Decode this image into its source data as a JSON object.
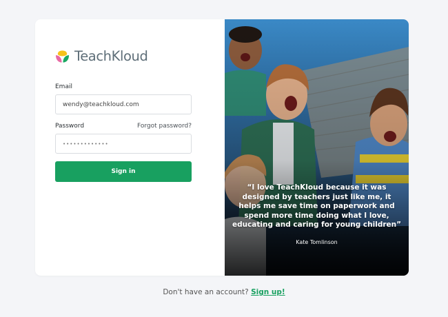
{
  "brand": {
    "name": "TeachKloud",
    "accent": "#18a060"
  },
  "form": {
    "email_label": "Email",
    "email_value": "wendy@teachkloud.com",
    "password_label": "Password",
    "forgot_link": "Forgot password?",
    "password_value": "•••••••••••••",
    "signin_label": "Sign in"
  },
  "testimonial": {
    "quote": "“I love TeachKloud because it was designed by teachers just like me, it helps me save time on paperwork and spend more time doing what I love, educating and caring for young children”",
    "author": "Kate Tomlinson"
  },
  "footer": {
    "prompt": "Don't have an account?",
    "signup_link": "Sign up!"
  },
  "icons": {
    "logo": "teachkloud-logo-icon"
  }
}
